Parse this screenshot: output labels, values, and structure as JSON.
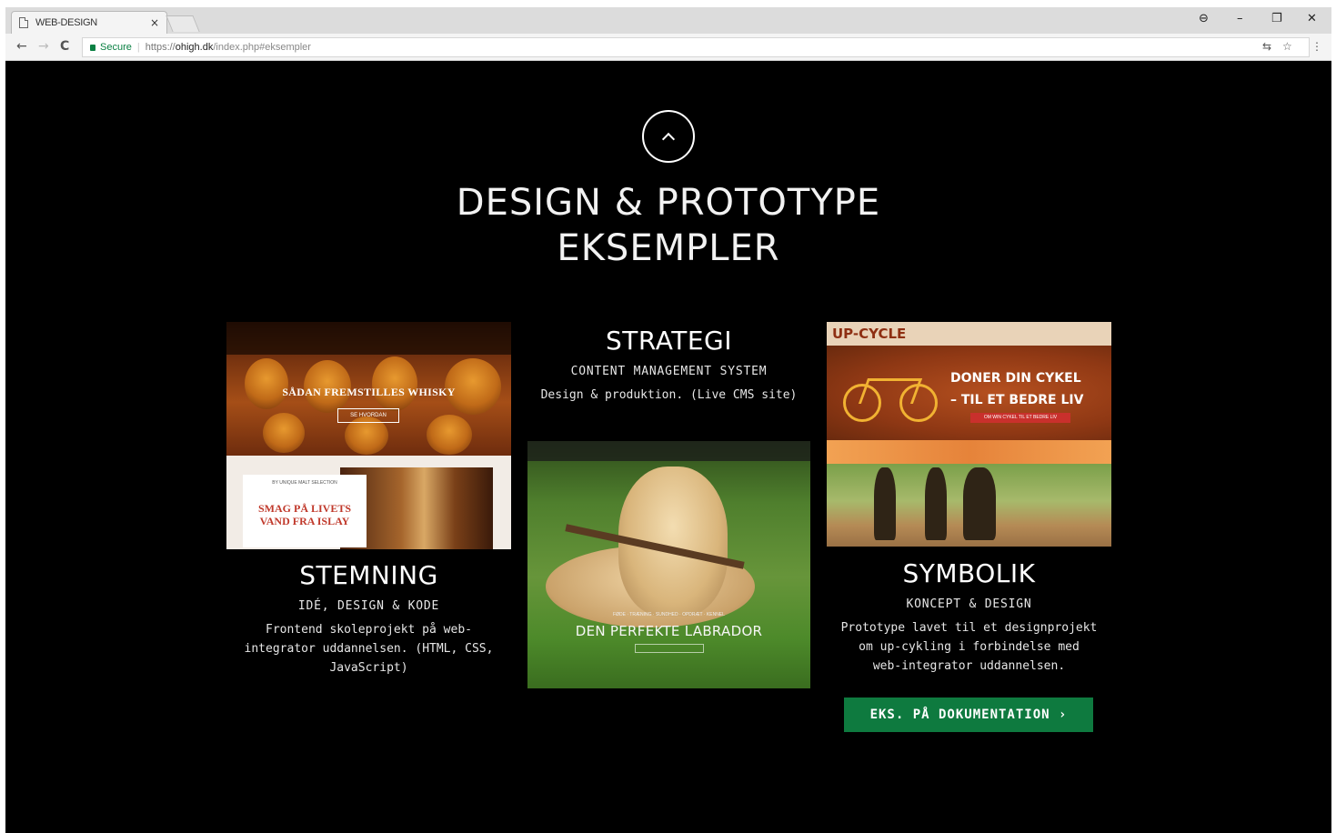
{
  "browser": {
    "tab_title": "WEB-DESIGN",
    "tab_close": "×",
    "secure_label": "Secure",
    "url_prefix": "https://",
    "url_host": "ohigh.dk",
    "url_path": "/index.php#eksempler",
    "window_controls": [
      "⊖",
      "–",
      "❐",
      "✕"
    ],
    "nav": {
      "back": "←",
      "forward": "→",
      "reload": "C"
    },
    "toolbar_icons": [
      "translate-icon",
      "star-icon",
      "menu-icon"
    ]
  },
  "page": {
    "heading_line1": "DESIGN & PROTOTYPE",
    "heading_line2": "EKSEMPLER",
    "columns": {
      "left": {
        "title": "STEMNING",
        "subtitle": "IDÉ, DESIGN & KODE",
        "description_lines": [
          "Frontend skoleprojekt på web-",
          "integrator uddannelsen. (HTML, CSS,",
          "JavaScript)"
        ],
        "thumb": {
          "headline": "SÅDAN FREMSTILLES WHISKY",
          "button": "SE HVORDAN",
          "card_small": "BY UNIQUE MALT SELECTION",
          "card_line1": "SMAG PÅ LIVETS",
          "card_line2": "VAND FRA ISLAY"
        }
      },
      "center": {
        "title": "STRATEGI",
        "subtitle": "CONTENT MANAGEMENT SYSTEM",
        "description": "Design & produktion. (Live CMS site)",
        "thumb": {
          "headline": "DEN PERFEKTE LABRADOR",
          "links": "FØDE · TRÆNING · SUNDHED · OPDRÆT · KENNEL"
        }
      },
      "right": {
        "title": "SYMBOLIK",
        "subtitle": "KONCEPT & DESIGN",
        "description_lines": [
          "Prototype lavet til et designprojekt",
          "om up-cykling i forbindelse med",
          "web-integrator uddannelsen."
        ],
        "thumb": {
          "logo": "UP-CYCLE",
          "hero_line1": "DONER DIN CYKEL",
          "hero_line2": "– TIL ET BEDRE LIV",
          "hero_button": "OM WIN CYKEL TIL ET BEDRE LIV"
        },
        "button_label": "EKS. PÅ DOKUMENTATION ›"
      }
    }
  },
  "colors": {
    "background": "#000000",
    "accent_button": "#0e7a3f",
    "secure_green": "#0b8043"
  }
}
